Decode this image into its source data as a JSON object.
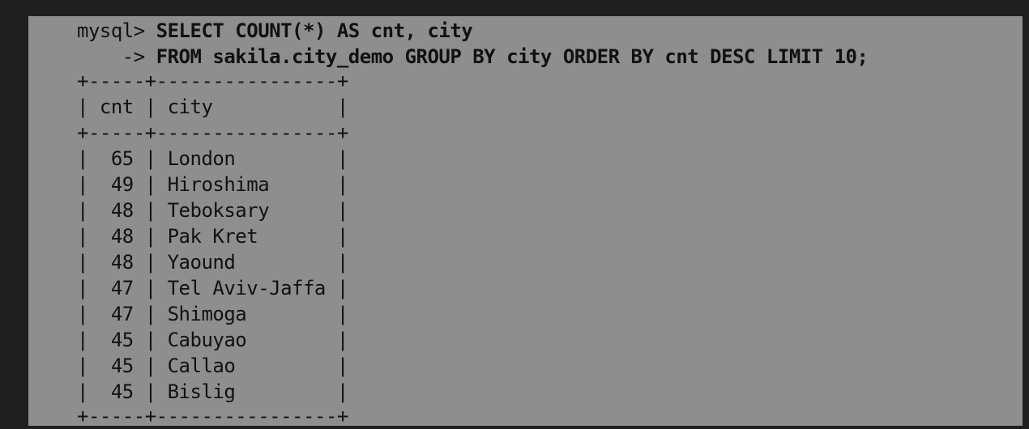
{
  "terminal": {
    "prompt": "mysql> ",
    "query_line_1": "SELECT COUNT(*) AS cnt, city",
    "continuation_prompt": "    -> ",
    "query_line_2": "FROM sakila.city_demo GROUP BY city ORDER BY cnt DESC LIMIT 10;",
    "border_line": "+-----+----------------+",
    "header_row": "| cnt | city           |",
    "rows": [
      "|  65 | London         |",
      "|  49 | Hiroshima      |",
      "|  48 | Teboksary      |",
      "|  48 | Pak Kret       |",
      "|  48 | Yaound         |",
      "|  47 | Tel Aviv-Jaffa |",
      "|  47 | Shimoga        |",
      "|  45 | Cabuyao        |",
      "|  45 | Callao         |",
      "|  45 | Bislig         |"
    ]
  }
}
